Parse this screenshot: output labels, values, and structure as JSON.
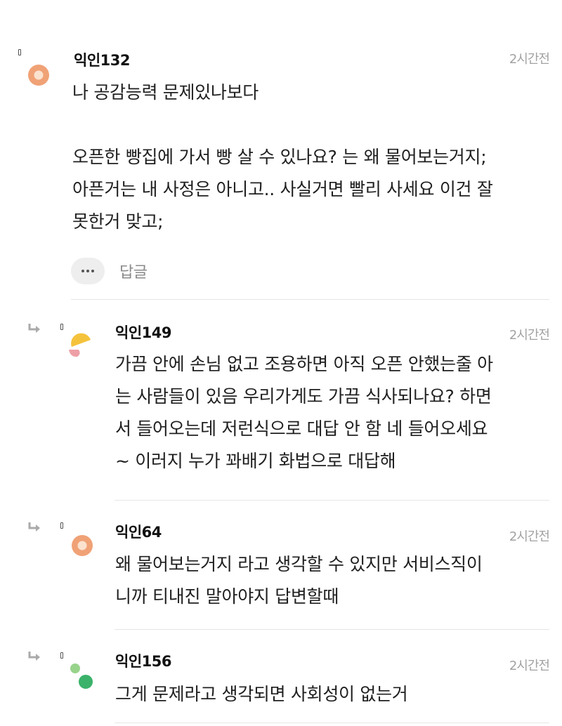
{
  "comments": [
    {
      "author": "익인132",
      "time": "2시간전",
      "lines": [
        "나 공감능력 문제있나보다",
        "",
        "오픈한 빵집에 가서 빵 살 수 있나요? 는 왜 물어보는거지;",
        "아픈거는 내 사정은 아니고.. 사실거면 빨리 사세요 이건 잘",
        "못한거 맞고;"
      ],
      "reply_label": "답글",
      "avatar_icon": "orange-circle-avatar"
    },
    {
      "author": "익인149",
      "time": "2시간전",
      "lines": [
        "가끔 안에 손님 없고 조용하면 아직 오픈 안했는줄 아",
        "는 사람들이 있음 우리가게도 가끔 식사되나요? 하면",
        "서 들어오는데 저런식으로 대답 안 함 네 들어오세요",
        "~ 이러지 누가 꽈배기 화법으로 대답해"
      ],
      "avatar_icon": "yellow-pink-avatar"
    },
    {
      "author": "익인64",
      "time": "2시간전",
      "lines": [
        "왜 물어보는거지 라고 생각할 수 있지만 서비스직이",
        "니까 티내진 말아야지 답변할때"
      ],
      "avatar_icon": "orange-circle-avatar"
    },
    {
      "author": "익인156",
      "time": "2시간전",
      "lines": [
        "그게 문제라고 생각되면 사회성이 없는거"
      ],
      "avatar_icon": "green-dots-avatar"
    }
  ],
  "colors": {
    "avatar_orange": "#f0a276",
    "avatar_yellow": "#f5c23c",
    "avatar_pink": "#ee9fa6",
    "avatar_green_light": "#98d38c",
    "avatar_green_dark": "#3ab26a",
    "time_gray": "#a2a2a2",
    "divider": "#e6e6e6"
  }
}
